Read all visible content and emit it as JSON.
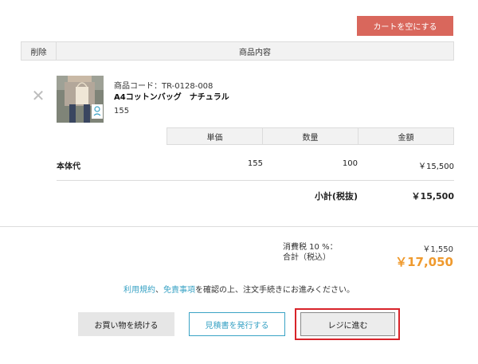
{
  "cart": {
    "empty_button": "カートを空にする",
    "header": {
      "delete": "削除",
      "content": "商品内容"
    },
    "remove_icon": "close-icon",
    "item": {
      "code": "商品コード：TR-0128-008",
      "name": "A4コットンバッグ　ナチュラル",
      "quantity_text": "155"
    },
    "price_header": {
      "unit_price": "単価",
      "quantity": "数量",
      "amount": "金額"
    },
    "body_row": {
      "label": "本体代",
      "unit_price": "155",
      "quantity": "100",
      "amount": "￥15,500"
    },
    "subtotal": {
      "label": "小計(税抜)",
      "value": "￥15,500"
    }
  },
  "totals": {
    "tax_label": "消費税 10 %：",
    "tax_value": "￥1,550",
    "total_label": "合計（税込）",
    "total_value": "￥17,050",
    "total_color": "#ef9a2e"
  },
  "notice": {
    "terms_link": "利用規約",
    "separator": "、",
    "disclaimer_link": "免責事項",
    "text": "を確認の上、注文手続きにお進みください。"
  },
  "actions": {
    "continue": "お買い物を続ける",
    "quote": "見積書を発行する",
    "checkout": "レジに進む"
  },
  "colors": {
    "accent_red": "#d9675c",
    "link_blue": "#3aa3c5",
    "highlight_red": "#d8232a"
  }
}
